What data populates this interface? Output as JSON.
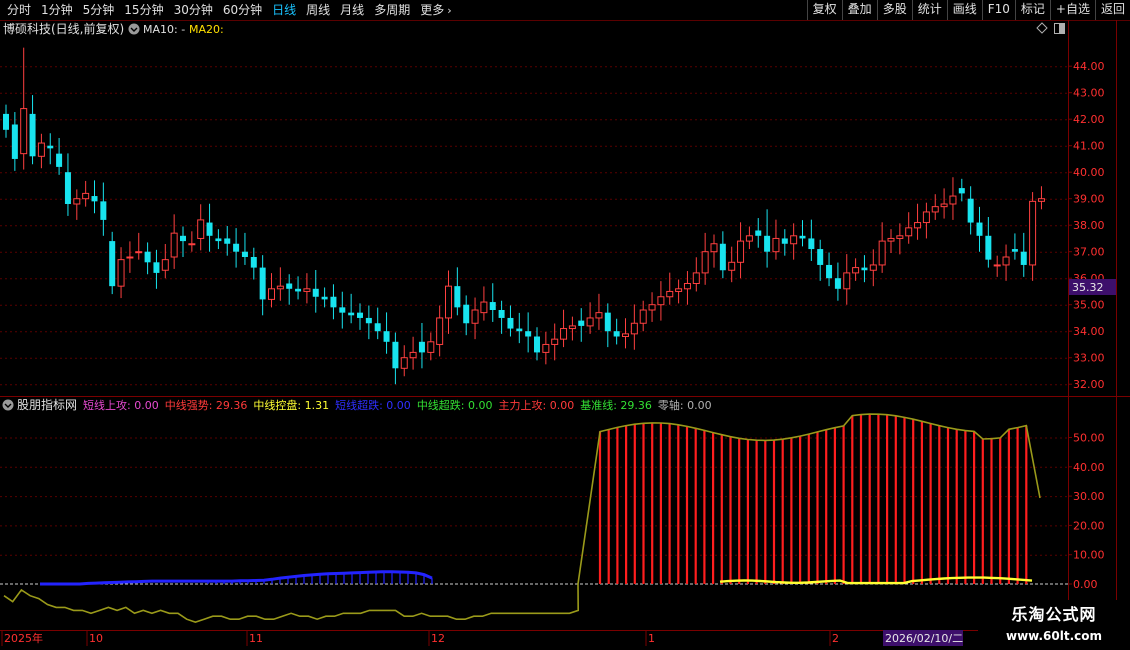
{
  "toolbar": {
    "periods": [
      {
        "label": "分时",
        "active": false
      },
      {
        "label": "1分钟",
        "active": false
      },
      {
        "label": "5分钟",
        "active": false
      },
      {
        "label": "15分钟",
        "active": false
      },
      {
        "label": "30分钟",
        "active": false
      },
      {
        "label": "60分钟",
        "active": false
      },
      {
        "label": "日线",
        "active": true
      },
      {
        "label": "周线",
        "active": false
      },
      {
        "label": "月线",
        "active": false
      },
      {
        "label": "多周期",
        "active": false
      }
    ],
    "more_label": "更多",
    "buttons": [
      "复权",
      "叠加",
      "多股",
      "统计",
      "画线",
      "F10",
      "标记",
      "+自选",
      "返回"
    ]
  },
  "main_panel": {
    "title": "博硕科技(日线,前复权)",
    "ma10_label": "MA10: -",
    "ma20_label": "MA20:",
    "price_ticks": [
      "44.00",
      "43.00",
      "42.00",
      "41.00",
      "40.00",
      "39.00",
      "38.00",
      "37.00",
      "36.00",
      "35.00",
      "34.00",
      "33.00",
      "32.00"
    ],
    "current_price": "35.32"
  },
  "indicator_panel": {
    "name": "股朋指标网",
    "legend": [
      {
        "text": "短线上攻: 0.00",
        "color": "#e64ad1"
      },
      {
        "text": "中线强势: 29.36",
        "color": "#ff3a3a"
      },
      {
        "text": "中线控盘: 1.31",
        "color": "#ffff33"
      },
      {
        "text": "短线超跌: 0.00",
        "color": "#2f2fff"
      },
      {
        "text": "中线超跌: 0.00",
        "color": "#33e033"
      },
      {
        "text": "主力上攻: 0.00",
        "color": "#ff3a3a"
      },
      {
        "text": "基准线: 29.36",
        "color": "#33e033"
      },
      {
        "text": "零轴: 0.00",
        "color": "#b0b0b0"
      }
    ],
    "ticks": [
      "50.00",
      "40.00",
      "30.00",
      "20.00",
      "10.00",
      "0.00"
    ]
  },
  "time_axis": {
    "labels": [
      "2025年",
      "10",
      "11",
      "12",
      "1",
      "2"
    ],
    "cursor_date": "2026/02/10/二"
  },
  "colors": {
    "up": "#ff4040",
    "down": "#18e4ef",
    "grid": "#5a0000",
    "price_label": "#ff3030",
    "current_price_bg": "#3d0f6b",
    "short_attack_blue": "#2323ff",
    "mid_strong_red": "#ff1e1e",
    "baseline": "#9a9a1a",
    "mid_control": "#ffff33"
  },
  "watermark": {
    "title": "乐淘公式网",
    "url": "www.60lt.com"
  }
}
